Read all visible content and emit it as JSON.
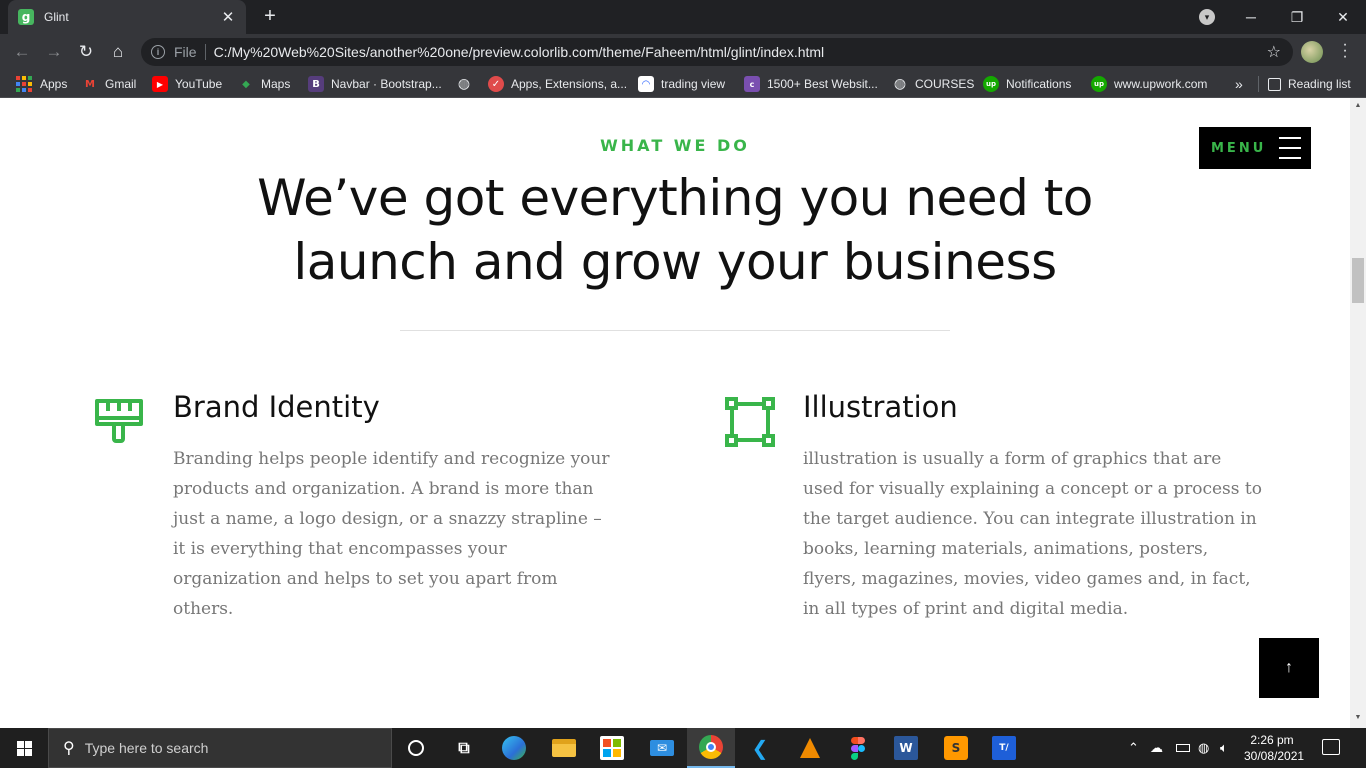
{
  "browser": {
    "tab_title": "Glint",
    "tab_favicon_letter": "g",
    "tab_close": "✕",
    "new_tab": "+",
    "scheme_label": "File",
    "url": "C:/My%20Web%20Sites/another%20one/preview.colorlib.com/theme/Faheem/html/glint/index.html",
    "reading_list": "Reading list",
    "more_bookmarks": "»"
  },
  "bookmarks": [
    {
      "label": "Apps"
    },
    {
      "label": "Gmail",
      "icon": "M",
      "color": "#ea4335"
    },
    {
      "label": "YouTube",
      "icon": "▶",
      "color": "#ff0000"
    },
    {
      "label": "Maps",
      "icon": "◆",
      "color": "#34a853"
    },
    {
      "label": "Navbar · Bootstrap...",
      "icon": "B",
      "color": "#563d7c"
    },
    {
      "label": "",
      "icon": "◍",
      "color": "#5f6368"
    },
    {
      "label": "Apps, Extensions, a...",
      "icon": "✓",
      "color": "#e04b4b"
    },
    {
      "label": "trading view",
      "icon": "◠",
      "color": "#2962ff"
    },
    {
      "label": "1500+ Best Websit...",
      "icon": "c",
      "color": "#7a4fb0"
    },
    {
      "label": "COURSES",
      "icon": "◍",
      "color": "#5f6368"
    },
    {
      "label": "Notifications",
      "icon": "up",
      "color": "#14a800"
    },
    {
      "label": "www.upwork.com",
      "icon": "up",
      "color": "#14a800"
    }
  ],
  "page": {
    "eyebrow": "WHAT WE DO",
    "headline_line1": "We’ve got everything you need to",
    "headline_line2": "launch and grow your business",
    "menu_label": "MENU",
    "go_top": "↑",
    "accent": "#39b54a",
    "services": [
      {
        "title": "Brand Identity",
        "icon": "paint-brush-icon",
        "description": "Branding helps people identify and recognize your products and organization. A brand is more than just a name, a logo design, or a snazzy strapline – it is everything that encompasses your organization and helps to set you apart from others."
      },
      {
        "title": "Illustration",
        "icon": "vector-square-icon",
        "description": "illustration is usually a form of graphics that are used for visually explaining a concept or a process to the target audience. You can integrate illustration in books, learning materials, animations, posters, flyers, magazines, movies, video games and, in fact, in all types of print and digital media."
      }
    ]
  },
  "taskbar": {
    "search_placeholder": "Type here to search",
    "time": "2:26 pm",
    "date": "30/08/2021"
  }
}
